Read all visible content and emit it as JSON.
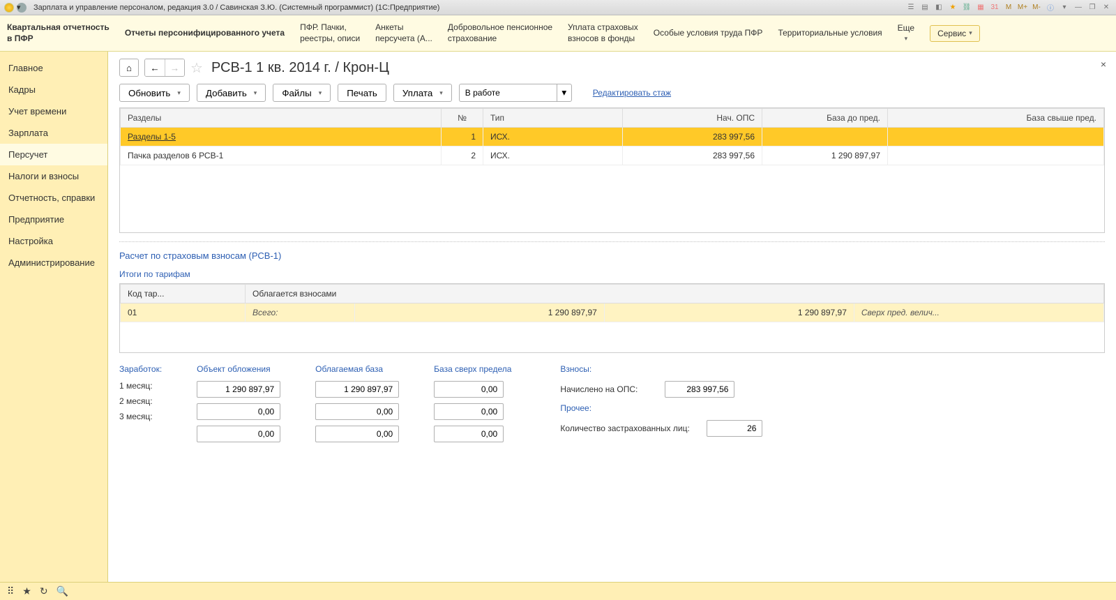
{
  "titlebar": {
    "title": "Зарплата и управление персоналом, редакция 3.0 / Савинская З.Ю. (Системный программист)  (1С:Предприятие)",
    "memory": {
      "m": "M",
      "mplus": "M+",
      "mminus": "M-"
    }
  },
  "sections": {
    "items": [
      {
        "line1": "Квартальная отчетность",
        "line2": "в ПФР",
        "bold": true
      },
      {
        "line1": "Отчеты персонифицированного учета",
        "line2": "",
        "bold": true
      },
      {
        "line1": "ПФР. Пачки,",
        "line2": "реестры, описи"
      },
      {
        "line1": "Анкеты",
        "line2": "персучета (А..."
      },
      {
        "line1": "Добровольное пенсионное",
        "line2": "страхование"
      },
      {
        "line1": "Уплата страховых",
        "line2": "взносов в фонды"
      },
      {
        "line1": "Особые условия труда ПФР",
        "line2": ""
      },
      {
        "line1": "Территориальные условия",
        "line2": ""
      }
    ],
    "more": "Еще",
    "service": "Сервис"
  },
  "sidebar": {
    "items": [
      "Главное",
      "Кадры",
      "Учет времени",
      "Зарплата",
      "Персучет",
      "Налоги и взносы",
      "Отчетность, справки",
      "Предприятие",
      "Настройка",
      "Администрирование"
    ],
    "active": 4
  },
  "doc": {
    "title": "РСВ-1 1 кв. 2014 г. / Крон-Ц",
    "toolbar": {
      "refresh": "Обновить",
      "add": "Добавить",
      "files": "Файлы",
      "print": "Печать",
      "pay": "Уплата",
      "status": "В работе",
      "edit_link": "Редактировать стаж"
    },
    "table1": {
      "headers": [
        "Разделы",
        "№",
        "Тип",
        "Нач. ОПС",
        "База до пред.",
        "База свыше пред."
      ],
      "rows": [
        {
          "sections": "Разделы 1-5",
          "num": "1",
          "type": "ИСХ.",
          "ops": "283 997,56",
          "base_to": "",
          "base_over": "",
          "selected": true
        },
        {
          "sections": "Пачка разделов 6 РСВ-1",
          "num": "2",
          "type": "ИСХ.",
          "ops": "283 997,56",
          "base_to": "1 290 897,97",
          "base_over": ""
        }
      ]
    },
    "subtitle1": "Расчет по страховым взносам (РСВ-1)",
    "subtitle2": "Итоги по тарифам",
    "table2": {
      "headers": [
        "Код тар...",
        "Облагается взносами"
      ],
      "row": {
        "code": "01",
        "total_label": "Всего:",
        "v1": "1 290 897,97",
        "v2": "1 290 897,97",
        "over_label": "Сверх пред. велич..."
      }
    },
    "form": {
      "earnings_header": "Заработок:",
      "obj_header": "Объект обложения",
      "base_header": "Облагаемая база",
      "over_header": "База сверх предела",
      "months": [
        "1 месяц:",
        "2 месяц:",
        "3 месяц:"
      ],
      "obj_values": [
        "1 290 897,97",
        "0,00",
        "0,00"
      ],
      "base_values": [
        "1 290 897,97",
        "0,00",
        "0,00"
      ],
      "over_values": [
        "0,00",
        "0,00",
        "0,00"
      ],
      "contrib_header": "Взносы:",
      "ops_label": "Начислено на ОПС:",
      "ops_value": "283 997,56",
      "other_header": "Прочее:",
      "insured_label": "Количество застрахованных лиц:",
      "insured_value": "26"
    }
  }
}
